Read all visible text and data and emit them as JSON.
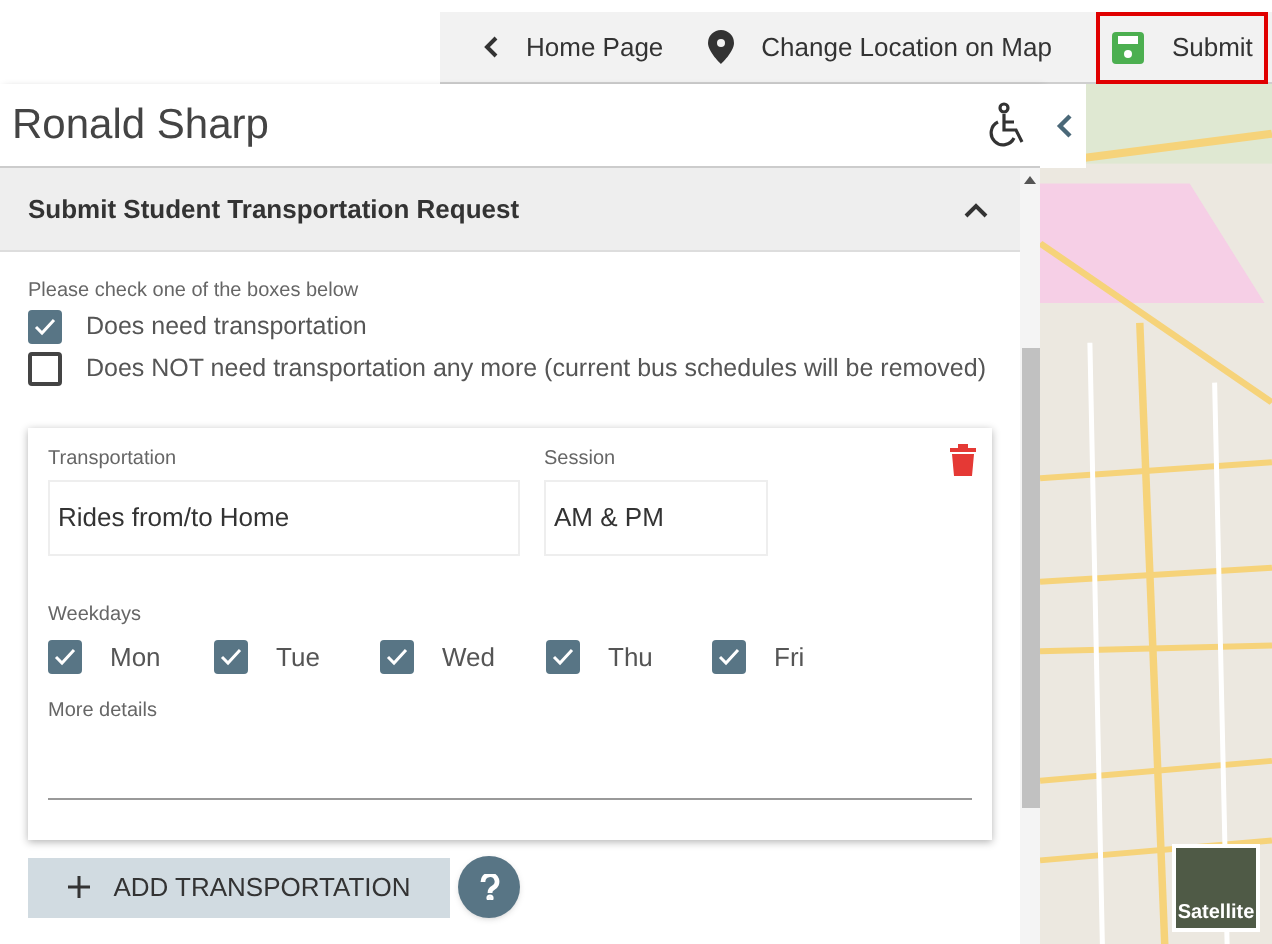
{
  "toolbar": {
    "items": [
      {
        "kind": "back",
        "label": "Home Page"
      },
      {
        "kind": "location",
        "label": "Change Location on Map"
      },
      {
        "kind": "save",
        "label": "Submit",
        "highlighted": true
      }
    ]
  },
  "student": {
    "name": "Ronald Sharp"
  },
  "section": {
    "title": "Submit Student Transportation Request",
    "expanded": true
  },
  "prompt": "Please check one of the boxes below",
  "options": [
    {
      "label": "Does need transportation",
      "checked": true
    },
    {
      "label": "Does NOT need transportation any more (current bus schedules will be removed)",
      "checked": false
    }
  ],
  "card": {
    "transportation": {
      "label": "Transportation",
      "value": "Rides from/to Home"
    },
    "session": {
      "label": "Session",
      "value": "AM & PM"
    },
    "weekdays_label": "Weekdays",
    "weekdays": [
      {
        "label": "Mon",
        "checked": true
      },
      {
        "label": "Tue",
        "checked": true
      },
      {
        "label": "Wed",
        "checked": true
      },
      {
        "label": "Thu",
        "checked": true
      },
      {
        "label": "Fri",
        "checked": true
      }
    ],
    "details": {
      "label": "More details"
    }
  },
  "add_button": "ADD TRANSPORTATION",
  "map": {
    "kind": "picture",
    "layer_button": "Satellite"
  }
}
